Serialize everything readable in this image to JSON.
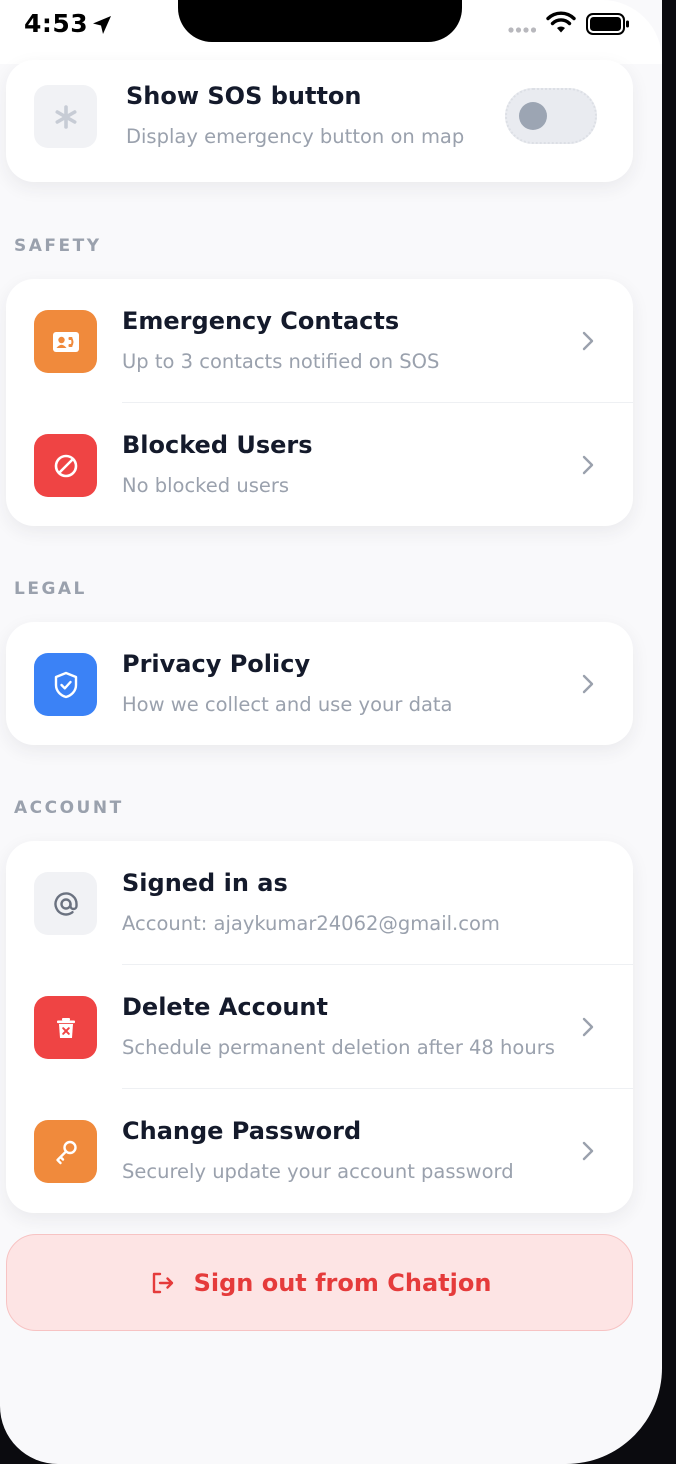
{
  "status_bar": {
    "time": "4:53"
  },
  "colors": {
    "orange": "#f08a3c",
    "red": "#ef4444",
    "blue": "#3b82f6",
    "gray_tile": "#f1f2f5",
    "signout_text": "#e53b3b"
  },
  "sos": {
    "icon": "asterisk-icon",
    "title": "Show SOS button",
    "subtitle": "Display emergency button on map",
    "enabled": false
  },
  "sections": {
    "safety": {
      "label": "SAFETY",
      "items": [
        {
          "icon": "contact-card-icon",
          "title": "Emergency Contacts",
          "subtitle": "Up to 3 contacts notified on SOS"
        },
        {
          "icon": "block-icon",
          "title": "Blocked Users",
          "subtitle": "No blocked users"
        }
      ]
    },
    "legal": {
      "label": "LEGAL",
      "items": [
        {
          "icon": "shield-check-icon",
          "title": "Privacy Policy",
          "subtitle": "How we collect and use your data"
        }
      ]
    },
    "account": {
      "label": "ACCOUNT",
      "items": [
        {
          "icon": "at-icon",
          "title": "Signed in as",
          "subtitle": "Account: ajaykumar24062@gmail.com"
        },
        {
          "icon": "trash-icon",
          "title": "Delete Account",
          "subtitle": "Schedule permanent deletion after 48 hours"
        },
        {
          "icon": "key-icon",
          "title": "Change Password",
          "subtitle": "Securely update your account password"
        }
      ]
    }
  },
  "signout": {
    "icon": "logout-icon",
    "label": "Sign out from Chatjon"
  }
}
